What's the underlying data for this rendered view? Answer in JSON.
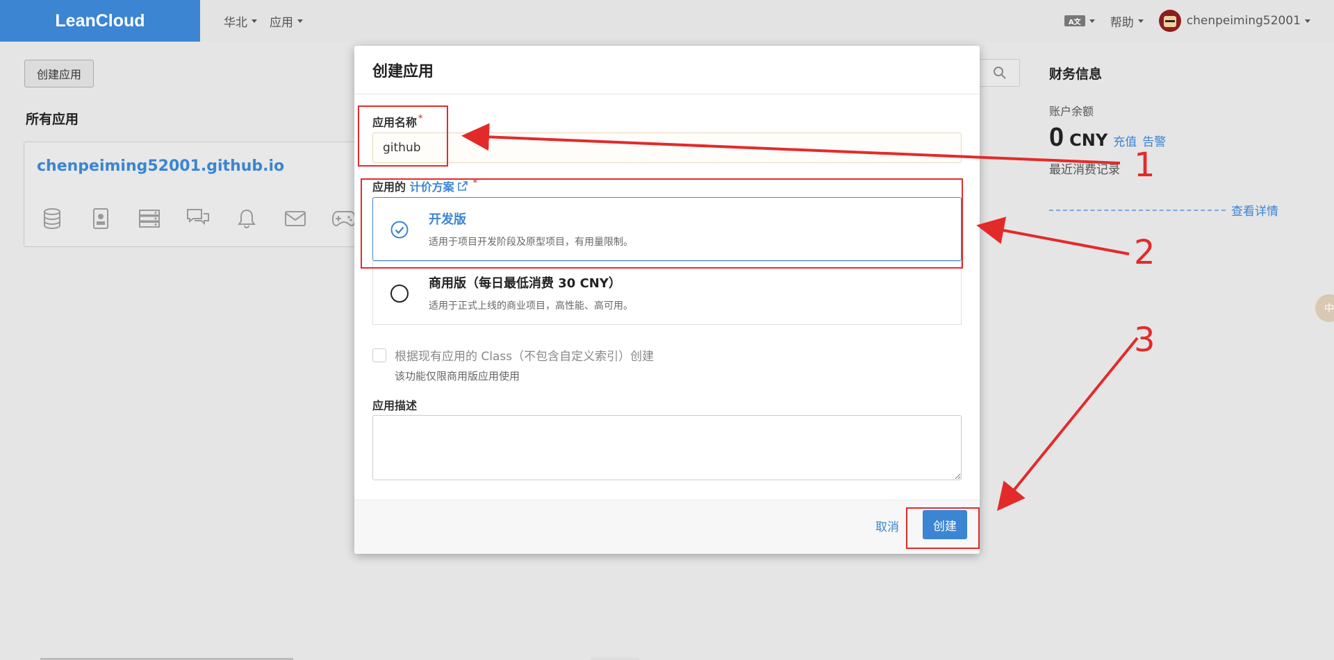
{
  "navbar": {
    "brand": "LeanCloud",
    "region": "华北",
    "apps_menu": "应用",
    "lang_icon_text": "A文",
    "help": "帮助",
    "username": "chenpeiming52001"
  },
  "page": {
    "create_app_button": "创建应用",
    "all_apps_title": "所有应用",
    "app_card": {
      "name": "chenpeiming52001.github.io",
      "icons": [
        "database-icon",
        "contact-card-icon",
        "server-icon",
        "chat-icon",
        "bell-icon",
        "mail-icon",
        "gamepad-icon"
      ]
    },
    "finance": {
      "title": "财务信息",
      "balance_label": "账户余额",
      "balance_value": "0",
      "balance_unit": "CNY",
      "recharge_link": "充值",
      "alert_link": "告警",
      "recent_label": "最近消费记录",
      "details_link": "查看详情"
    },
    "side_float_text": "中"
  },
  "modal": {
    "title": "创建应用",
    "name_label": "应用名称",
    "name_value": "github",
    "plan_label_prefix": "应用的",
    "plan_label_link": "计价方案",
    "plans": [
      {
        "name": "开发版",
        "desc": "适用于项目开发阶段及原型项目，有用量限制。",
        "selected": true
      },
      {
        "name": "商用版（每日最低消费 30 CNY）",
        "desc": "适用于正式上线的商业项目，高性能、高可用。",
        "selected": false
      }
    ],
    "copy_class_label": "根据现有应用的 Class（不包含自定义索引）创建",
    "copy_class_note": "该功能仅限商用版应用使用",
    "desc_label": "应用描述",
    "cancel": "取消",
    "create": "创建"
  },
  "annotations": {
    "numbers": [
      "1",
      "2",
      "3"
    ],
    "color": "#e32a2a"
  },
  "colors": {
    "brand": "#3b85d3",
    "navbar_bg": "#e3e3e3",
    "overlay_bg": "#e5e5e5"
  }
}
